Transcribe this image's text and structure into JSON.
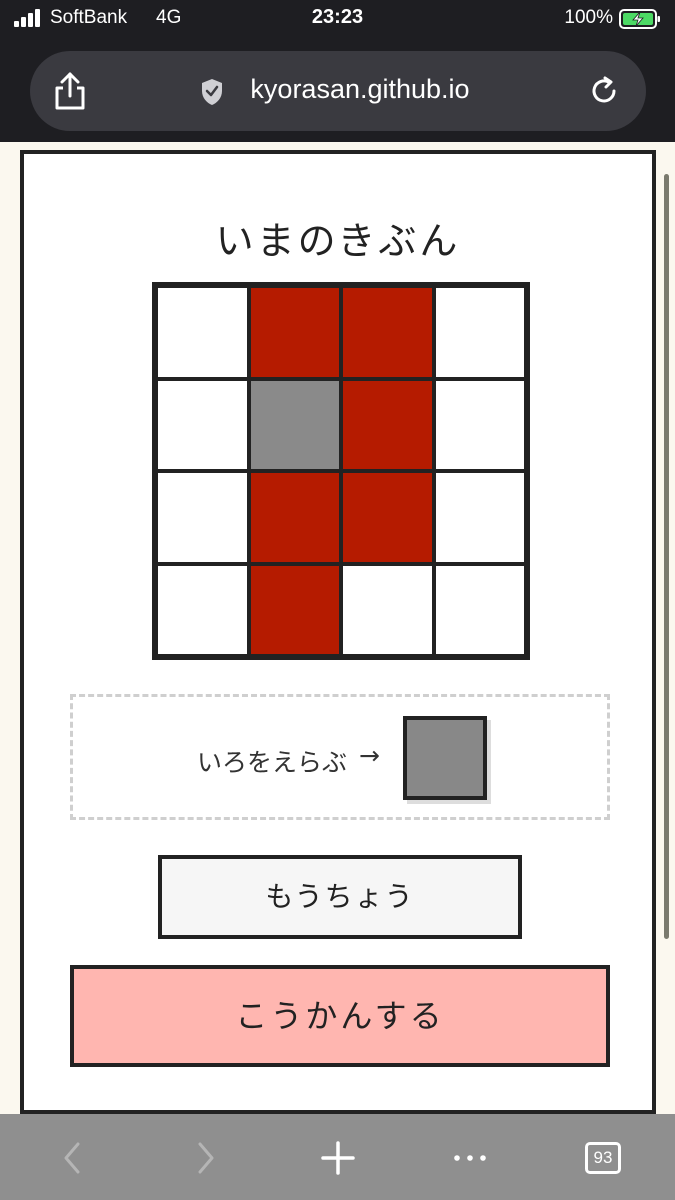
{
  "status_bar": {
    "carrier": "SoftBank",
    "network": "4G",
    "time": "23:23",
    "battery_percent": "100%"
  },
  "browser": {
    "url": "kyorasan.github.io",
    "tabs_count": "93"
  },
  "page": {
    "title": "いまのきぶん",
    "grid": {
      "rows": 4,
      "cols": 4,
      "cells": [
        "#ffffff",
        "#b51b00",
        "#b51b00",
        "#ffffff",
        "#ffffff",
        "#8a8a8a",
        "#b51b00",
        "#ffffff",
        "#ffffff",
        "#b51b00",
        "#b51b00",
        "#ffffff",
        "#ffffff",
        "#b51b00",
        "#ffffff",
        "#ffffff"
      ]
    },
    "picker": {
      "label": "いろをえらぶ",
      "arrow": "→",
      "selected_color": "#888888"
    },
    "again_button": "もうちょう",
    "exchange_button": "こうかんする"
  },
  "colors": {
    "accent_red": "#b51b00",
    "exchange_bg": "#ffb6b0",
    "border": "#222222"
  }
}
